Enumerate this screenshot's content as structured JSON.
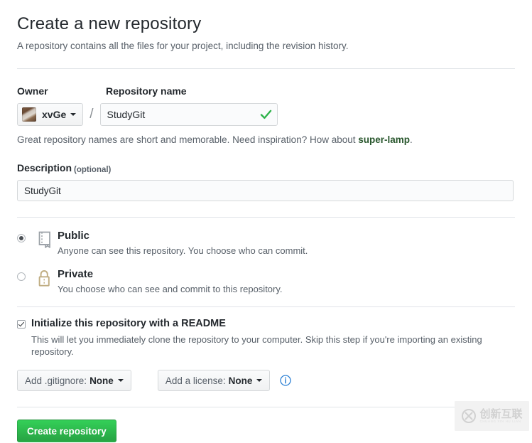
{
  "header": {
    "title": "Create a new repository",
    "subtitle": "A repository contains all the files for your project, including the revision history."
  },
  "owner": {
    "label": "Owner",
    "name": "xvGe",
    "avatar_icon": "user-avatar",
    "caret_icon": "chevron-down-icon"
  },
  "repository_name": {
    "label": "Repository name",
    "value": "StudyGit",
    "placeholder": "",
    "valid_icon": "check-icon",
    "separator": "/"
  },
  "hint": {
    "text_before": "Great repository names are short and memorable. Need inspiration? How about ",
    "suggestion": "super-lamp",
    "text_after": "."
  },
  "description": {
    "label": "Description",
    "optional_label": "(optional)",
    "value": "StudyGit",
    "placeholder": ""
  },
  "visibility": {
    "options": [
      {
        "id": "public",
        "title": "Public",
        "description": "Anyone can see this repository. You choose who can commit.",
        "icon": "repo-book-icon",
        "selected": true
      },
      {
        "id": "private",
        "title": "Private",
        "description": "You choose who can see and commit to this repository.",
        "icon": "lock-icon",
        "selected": false
      }
    ]
  },
  "readme": {
    "title": "Initialize this repository with a README",
    "description": "This will let you immediately clone the repository to your computer. Skip this step if you're importing an existing repository.",
    "checked": true
  },
  "templates": {
    "gitignore": {
      "label": "Add .gitignore:",
      "value": "None",
      "caret_icon": "chevron-down-icon"
    },
    "license": {
      "label": "Add a license:",
      "value": "None",
      "caret_icon": "chevron-down-icon"
    },
    "info_icon": "info-circle-icon"
  },
  "submit": {
    "label": "Create repository"
  },
  "watermark": {
    "logo_icon": "circle-x-logo",
    "chinese_text": "创新互联",
    "pinyin_text": "CHUANG XIN HU LIAN"
  },
  "colors": {
    "accent_green": "#28a745",
    "link_green": "#28562c",
    "border": "#d5d8da",
    "muted_text": "#586069",
    "info_blue": "#2a7fd4",
    "lock_gold": "#c0ad82"
  }
}
